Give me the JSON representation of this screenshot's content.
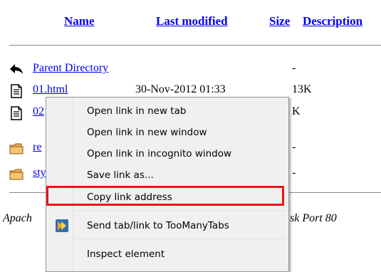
{
  "header": {
    "name": "Name",
    "last_modified": "Last modified",
    "size": "Size",
    "description": "Description"
  },
  "rows": [
    {
      "icon": "back-arrow-icon",
      "name": "Parent Directory",
      "date": "",
      "size": "-"
    },
    {
      "icon": "text-file-icon",
      "name": "01.html",
      "date": "30-Nov-2012 01:33",
      "size": "13K"
    },
    {
      "icon": "text-file-icon",
      "name": "02",
      "date": "",
      "size": "K"
    },
    {
      "icon": "folder-icon",
      "name": "re",
      "date": "",
      "size": "-"
    },
    {
      "icon": "folder-icon",
      "name": "sty",
      "date": "",
      "size": "-"
    }
  ],
  "address": {
    "left": "Apach",
    "right": "sk Port 80"
  },
  "context_menu": {
    "items": [
      {
        "label": "Open link in new tab"
      },
      {
        "label": "Open link in new window"
      },
      {
        "label": "Open link in incognito window"
      },
      {
        "label": "Save link as..."
      },
      {
        "label": "Copy link address",
        "highlighted": true
      },
      {
        "label": "Send tab/link to TooManyTabs",
        "icon": "toomanytabs-icon"
      },
      {
        "label": "Inspect element"
      }
    ],
    "highlight_color": "#e8151b"
  }
}
